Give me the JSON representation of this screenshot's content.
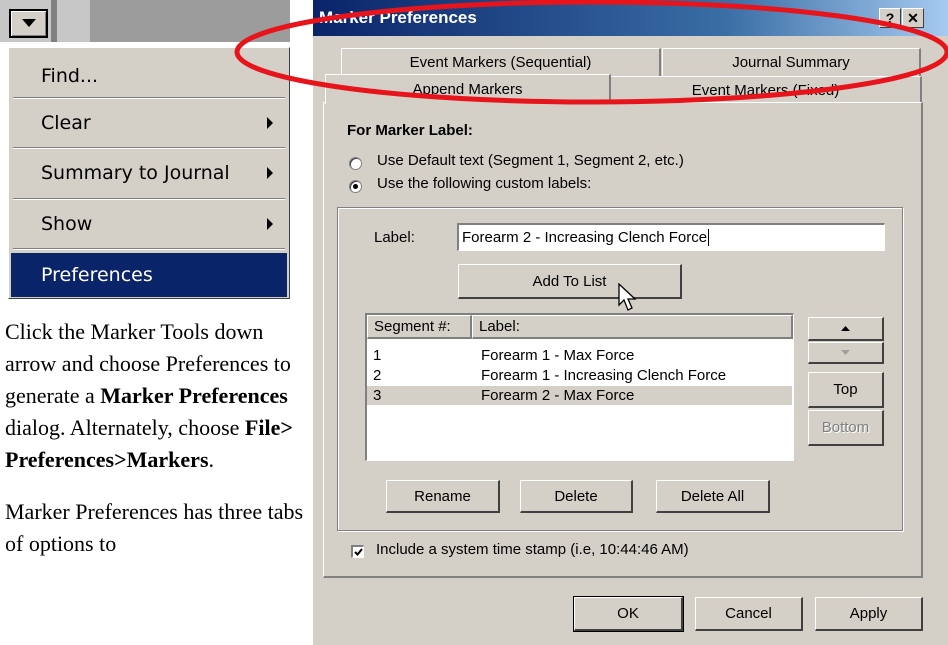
{
  "menu": {
    "items": [
      {
        "label": "Find...",
        "submenu": false
      },
      {
        "label": "Clear",
        "submenu": true
      },
      {
        "label": "Summary to Journal",
        "submenu": true
      },
      {
        "label": "Show",
        "submenu": true
      },
      {
        "label": "Preferences",
        "submenu": false,
        "selected": true
      }
    ]
  },
  "doc": {
    "para1": {
      "t1": "Click the Marker Tools down arrow and choose Preferences to generate a ",
      "b1": "Marker Preferences",
      "t2": " dialog. Alternately, choose ",
      "b2": "File> Preferences>Markers",
      "t3": "."
    },
    "para2": "Marker Preferences has three tabs of options to"
  },
  "dialog": {
    "title": "Marker Preferences",
    "help_glyph": "?",
    "close_glyph": "✕",
    "tabs": {
      "event_sequential": "Event Markers (Sequential)",
      "journal_summary": "Journal Summary",
      "append_markers": "Append Markers",
      "event_fixed": "Event Markers (Fixed)"
    },
    "section_title": "For Marker Label:",
    "radio_default": "Use Default text (Segment 1, Segment 2, etc.)",
    "radio_custom": "Use the following custom labels:",
    "label_caption": "Label:",
    "label_value": "Forearm 2 - Increasing Clench Force",
    "add_to_list": "Add To List",
    "list": {
      "col_segment": "Segment #:",
      "col_label": "Label:",
      "rows": [
        {
          "seg": "1",
          "label": "Forearm 1 - Max Force"
        },
        {
          "seg": "2",
          "label": "Forearm 1 - Increasing Clench Force"
        },
        {
          "seg": "3",
          "label": "Forearm 2 - Max Force"
        }
      ]
    },
    "btn_top": "Top",
    "btn_bottom": "Bottom",
    "btn_rename": "Rename",
    "btn_delete": "Delete",
    "btn_delete_all": "Delete All",
    "timestamp_label": "Include a system time stamp (i.e, 10:44:46 AM)",
    "btn_ok": "OK",
    "btn_cancel": "Cancel",
    "btn_apply": "Apply"
  },
  "colors": {
    "dialog_face": "#d4d0c8",
    "title_active": "#0a246a",
    "menu_highlight": "#0a246a",
    "annotation_ellipse": "#e8141b"
  }
}
